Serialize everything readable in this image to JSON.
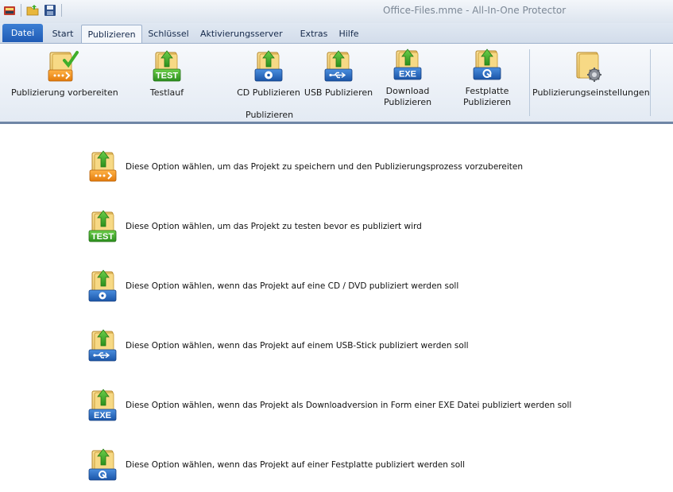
{
  "window": {
    "title": "Office-Files.mme  - All-In-One Protector"
  },
  "qat": [
    {
      "icon": "app-icon"
    },
    {
      "icon": "open-folder-icon"
    },
    {
      "icon": "save-icon"
    }
  ],
  "tabs": [
    "Datei",
    "Start",
    "Publizieren",
    "Schlüssel",
    "Aktivierungsserver",
    "Extras",
    "Hilfe"
  ],
  "ribbon": {
    "buttons": [
      {
        "label": "Publizierung vorbereiten",
        "icon": "prepare-publish-icon"
      },
      {
        "label": "Testlauf",
        "icon": "test-run-icon"
      },
      {
        "label": "CD Publizieren",
        "icon": "cd-publish-icon"
      },
      {
        "label": "USB Publizieren",
        "icon": "usb-publish-icon"
      },
      {
        "label": "Download\nPublizieren",
        "label1": "Download",
        "label2": "Publizieren",
        "icon": "exe-download-icon"
      },
      {
        "label1": "Festplatte",
        "label2": "Publizieren",
        "icon": "harddisk-publish-icon"
      },
      {
        "label": "Publizierungseinstellungen",
        "icon": "publish-settings-icon"
      }
    ],
    "group_label": "Publizieren"
  },
  "options": [
    {
      "text": "Diese Option wählen, um das Projekt zu speichern und den Publizierungsprozess vorzubereiten",
      "icon": "prepare-publish-icon"
    },
    {
      "text": "Diese Option wählen, um das Projekt zu testen bevor es publiziert wird",
      "icon": "test-run-icon"
    },
    {
      "text": "Diese Option wählen, wenn das Projekt auf eine CD / DVD publiziert werden soll",
      "icon": "cd-publish-icon"
    },
    {
      "text": "Diese Option wählen, wenn das Projekt auf einem USB-Stick publiziert werden soll",
      "icon": "usb-publish-icon"
    },
    {
      "text": "Diese Option wählen, wenn das Projekt als Downloadversion in Form einer EXE Datei publiziert werden soll",
      "icon": "exe-download-icon"
    },
    {
      "text": " Diese Option wählen, wenn das Projekt auf einer Festplatte publiziert werden soll",
      "icon": "harddisk-publish-icon"
    }
  ],
  "badges": {
    "test": "TEST",
    "exe": "EXE"
  },
  "colors": {
    "accent": "#1f5bb5",
    "ribbon_border": "#9db1cc",
    "folder": "#e8c46a",
    "arrow": "#3fae2a"
  }
}
